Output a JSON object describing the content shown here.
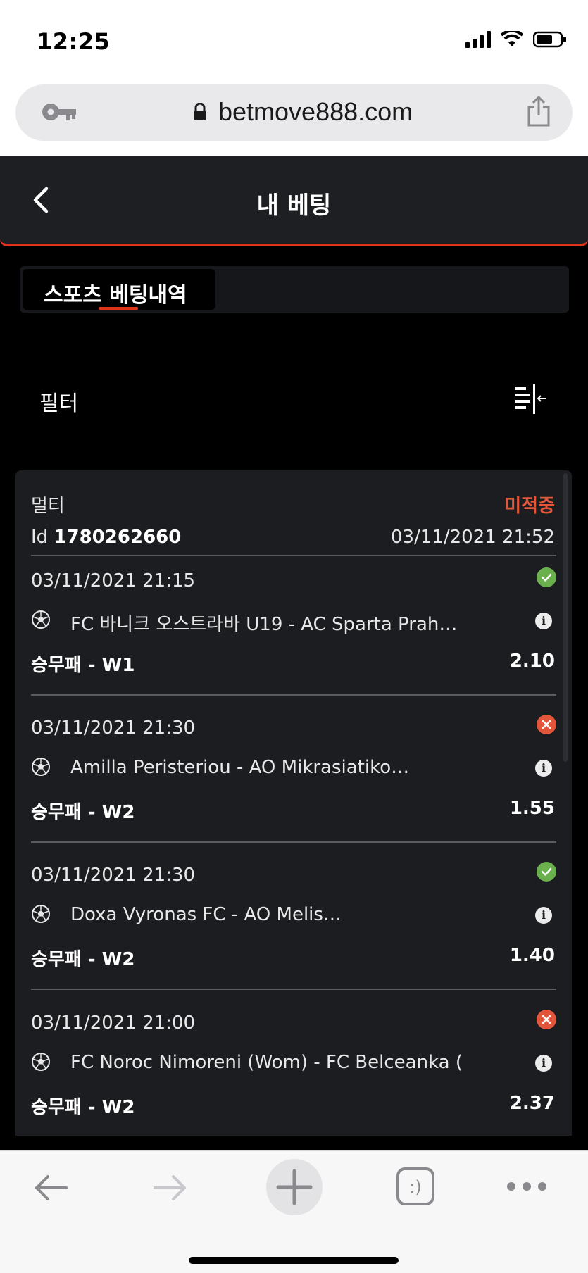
{
  "status_bar": {
    "time": "12:25"
  },
  "browser": {
    "url": "betmove888.com"
  },
  "header": {
    "title": "내 베팅"
  },
  "tabs": [
    {
      "label": "스포츠 베팅내역",
      "active": true
    }
  ],
  "filter": {
    "label": "필터"
  },
  "bet": {
    "type": "멀티",
    "status": "미적중",
    "id_label": "Id",
    "id_value": "1780262660",
    "placed_at": "03/11/2021 21:52",
    "legs": [
      {
        "date": "03/11/2021 21:15",
        "result": "win",
        "match": "FC 바니크 오스트라바 U19 - AC Sparta Prah…",
        "market": "승무패 - W1",
        "odds": "2.10"
      },
      {
        "date": "03/11/2021 21:30",
        "result": "lose",
        "match": "Amilla Peristeriou - AO Mikrasiatiko…",
        "market": "승무패 - W2",
        "odds": "1.55"
      },
      {
        "date": "03/11/2021 21:30",
        "result": "win",
        "match": "Doxa Vyronas FC - AO Melis…",
        "market": "승무패 - W2",
        "odds": "1.40"
      },
      {
        "date": "03/11/2021 21:00",
        "result": "lose",
        "match": "FC Noroc Nimoreni (Wom) - FC Belceanka (…",
        "market": "승무패 - W2",
        "odds": "2.37"
      }
    ]
  },
  "colors": {
    "accent": "#e2341d",
    "win": "#6ab04c",
    "lose": "#e2563b",
    "card_bg": "#1c1d21"
  },
  "icons": {
    "url_bar_left": "key-icon",
    "url_bar_right": "share-icon",
    "header_left": "back-icon",
    "filter": "filter-icon",
    "leg_sport": "soccer-ball-icon",
    "leg_info": "info-icon",
    "toolbar": [
      "back-arrow-icon",
      "forward-arrow-icon",
      "new-tab-plus-icon",
      "tabs-icon",
      "more-icon"
    ]
  }
}
